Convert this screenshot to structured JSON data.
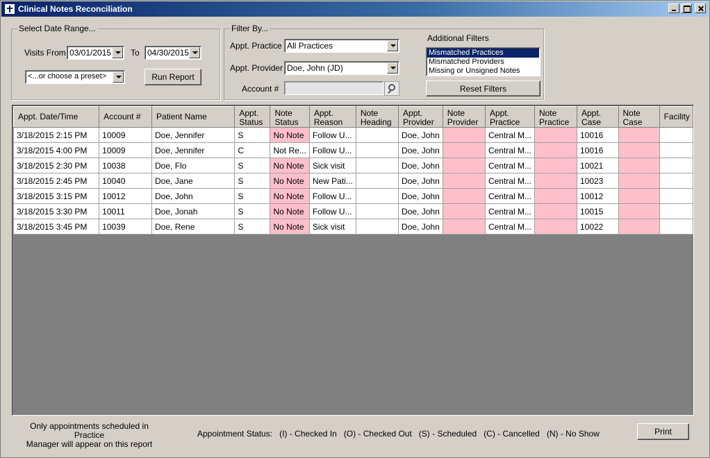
{
  "window": {
    "title": "Clinical Notes Reconciliation",
    "icon": "cross-icon"
  },
  "date_range": {
    "legend": "Select Date Range...",
    "visits_from_label": "Visits From",
    "from_value": "03/01/2015",
    "to_label": "To",
    "to_value": "04/30/2015",
    "preset_value": "<...or choose a preset>",
    "run_report_label": "Run Report"
  },
  "filter_by": {
    "legend": "Filter By...",
    "practice_label": "Appt. Practice",
    "practice_value": "All Practices",
    "provider_label": "Appt. Provider",
    "provider_value": "Doe, John (JD)",
    "account_label": "Account #",
    "account_value": ""
  },
  "additional_filters": {
    "label": "Additional Filters",
    "items": [
      "Mismatched Practices",
      "Mismatched Providers",
      "Missing or Unsigned Notes"
    ],
    "selected_index": 0,
    "reset_label": "Reset Filters"
  },
  "grid": {
    "columns": [
      {
        "line1": "Appt. Date/Time",
        "line2": ""
      },
      {
        "line1": "Account #",
        "line2": ""
      },
      {
        "line1": "Patient Name",
        "line2": ""
      },
      {
        "line1": "Appt.",
        "line2": "Status"
      },
      {
        "line1": "Note",
        "line2": "Status"
      },
      {
        "line1": "Appt.",
        "line2": "Reason"
      },
      {
        "line1": "Note",
        "line2": "Heading"
      },
      {
        "line1": "Appt.",
        "line2": "Provider"
      },
      {
        "line1": "Note",
        "line2": "Provider"
      },
      {
        "line1": "Appt.",
        "line2": "Practice"
      },
      {
        "line1": "Note",
        "line2": "Practice"
      },
      {
        "line1": "Appt.",
        "line2": "Case"
      },
      {
        "line1": "Note",
        "line2": "Case"
      },
      {
        "line1": "Facility",
        "line2": ""
      }
    ],
    "rows": [
      [
        "3/18/2015 2:15 PM",
        "10009",
        "Doe, Jennifer",
        "S",
        "No Note",
        "Follow U...",
        "",
        "Doe, John",
        "",
        "Central M...",
        "",
        "10016",
        "",
        ""
      ],
      [
        "3/18/2015 4:00 PM",
        "10009",
        "Doe, Jennifer",
        "C",
        "Not Re...",
        "Follow U...",
        "",
        "Doe, John",
        "",
        "Central M...",
        "",
        "10016",
        "",
        ""
      ],
      [
        "3/18/2015 2:30 PM",
        "10038",
        "Doe, Flo",
        "S",
        "No Note",
        "Sick visit",
        "",
        "Doe, John",
        "",
        "Central M...",
        "",
        "10021",
        "",
        ""
      ],
      [
        "3/18/2015 2:45 PM",
        "10040",
        "Doe, Jane",
        "S",
        "No Note",
        "New Pati...",
        "",
        "Doe, John",
        "",
        "Central M...",
        "",
        "10023",
        "",
        ""
      ],
      [
        "3/18/2015 3:15 PM",
        "10012",
        "Doe, John",
        "S",
        "No Note",
        "Follow U...",
        "",
        "Doe, John",
        "",
        "Central M...",
        "",
        "10012",
        "",
        ""
      ],
      [
        "3/18/2015 3:30 PM",
        "10011",
        "Doe, Jonah",
        "S",
        "No Note",
        "Follow U...",
        "",
        "Doe, John",
        "",
        "Central M...",
        "",
        "10015",
        "",
        ""
      ],
      [
        "3/18/2015 3:45 PM",
        "10039",
        "Doe, Rene",
        "S",
        "No Note",
        "Sick visit",
        "",
        "Doe, John",
        "",
        "Central M...",
        "",
        "10022",
        "",
        ""
      ]
    ],
    "highlight_color": "#ffc0cb"
  },
  "footer": {
    "note_line1": "Only appointments scheduled in Practice",
    "note_line2": "Manager will appear on this report",
    "status_legend": "Appointment Status:   (I) - Checked In   (O) - Checked Out   (S) - Scheduled   (C) - Cancelled   (N) - No Show",
    "print_label": "Print"
  }
}
